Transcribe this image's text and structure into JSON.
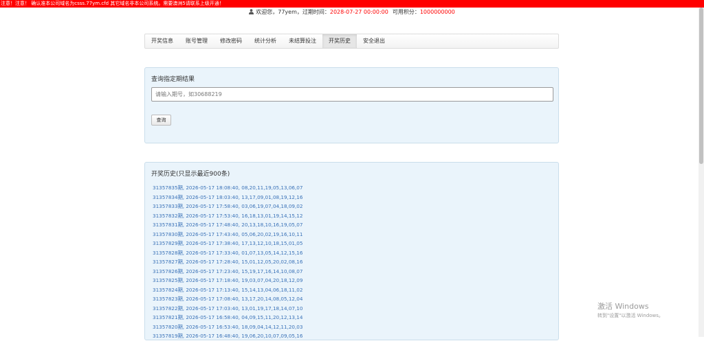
{
  "warning": {
    "text": "注意！注意！ 确认准本公司域名为csss.77ym.cfd 其它域名非本公司系统。需要澳洲5请联系上级开通！"
  },
  "userinfo": {
    "welcome": "欢迎您，77yem，",
    "expire_label": "过期时间：",
    "expire_value": "2028-07-27 00:00:00",
    "credits_label": "可用积分：",
    "credits_value": "1000000000"
  },
  "nav": {
    "items": [
      {
        "label": "开奖信息"
      },
      {
        "label": "账号管理"
      },
      {
        "label": "修改密码"
      },
      {
        "label": "统计分析"
      },
      {
        "label": "未结算投注"
      },
      {
        "label": "开奖历史"
      },
      {
        "label": "安全退出"
      }
    ],
    "active": "开奖历史"
  },
  "query": {
    "title": "查询指定期结果",
    "placeholder": "请输入期号，如30688219",
    "button": "查询"
  },
  "history": {
    "title": "开奖历史(只显示最近900条)",
    "rows": [
      "31357835期, 2026-05-17 18:08:40, 08,20,11,19,05,13,06,07",
      "31357834期, 2026-05-17 18:03:40, 13,17,09,01,08,19,12,16",
      "31357833期, 2026-05-17 17:58:40, 03,06,19,07,04,18,09,02",
      "31357832期, 2026-05-17 17:53:40, 16,18,13,01,19,14,15,12",
      "31357831期, 2026-05-17 17:48:40, 20,13,18,10,16,19,05,07",
      "31357830期, 2026-05-17 17:43:40, 05,06,20,02,19,16,10,11",
      "31357829期, 2026-05-17 17:38:40, 17,13,12,10,18,15,01,05",
      "31357828期, 2026-05-17 17:33:40, 01,07,13,05,14,12,15,16",
      "31357827期, 2026-05-17 17:28:40, 15,01,12,05,20,02,08,16",
      "31357826期, 2026-05-17 17:23:40, 15,19,17,16,14,10,08,07",
      "31357825期, 2026-05-17 17:18:40, 19,03,07,04,20,18,12,09",
      "31357824期, 2026-05-17 17:13:40, 15,14,13,04,06,18,11,02",
      "31357823期, 2026-05-17 17:08:40, 13,17,20,14,08,05,12,04",
      "31357822期, 2026-05-17 17:03:40, 13,01,19,17,18,14,07,10",
      "31357821期, 2026-05-17 16:58:40, 04,09,15,11,20,12,13,14",
      "31357820期, 2026-05-17 16:53:40, 18,09,04,14,12,11,20,03",
      "31357819期, 2026-05-17 16:48:40, 19,06,20,10,07,09,05,16"
    ]
  },
  "watermark": {
    "title": "激活 Windows",
    "subtitle": "转到\"设置\"以激活 Windows。"
  },
  "colors": {
    "warning_bg": "#ff0000",
    "highlight": "#ff0000",
    "link": "#3a72b8",
    "panel_bg": "#eaf4fb"
  },
  "icons": {
    "user": "user-icon"
  }
}
